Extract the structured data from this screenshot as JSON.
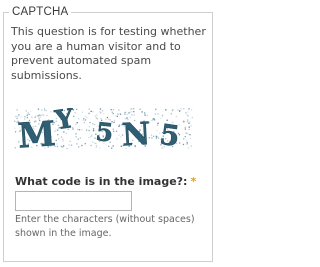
{
  "captcha": {
    "legend": "CAPTCHA",
    "description": "This question is for testing whether you are a human visitor and to prevent automated spam submissions.",
    "image_text": "MY5N5",
    "field_label": "What code is in the image?:",
    "required_marker": "*",
    "input_value": "",
    "help_text": "Enter the characters (without spaces) shown in the image."
  }
}
